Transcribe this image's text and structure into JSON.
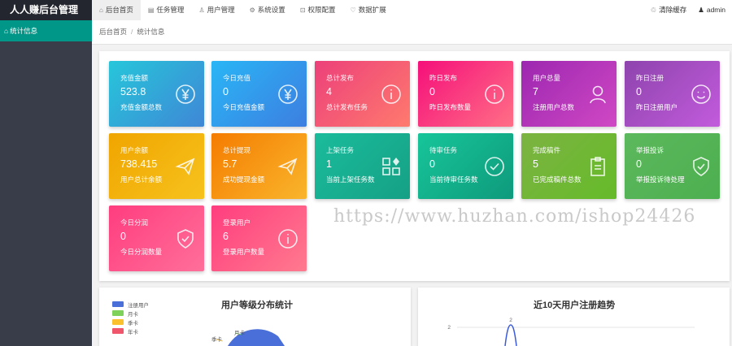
{
  "app": {
    "title": "人人赚后台管理"
  },
  "topnav": [
    {
      "label": "后台首页",
      "icon": "home-icon",
      "glyph": "⌂",
      "active": true
    },
    {
      "label": "任务管理",
      "icon": "task-icon",
      "glyph": "▤",
      "active": false
    },
    {
      "label": "用户管理",
      "icon": "user-icon",
      "glyph": "♙",
      "active": false
    },
    {
      "label": "系统设置",
      "icon": "gear-icon",
      "glyph": "⚙",
      "active": false
    },
    {
      "label": "权限配置",
      "icon": "lock-icon",
      "glyph": "⊡",
      "active": false
    },
    {
      "label": "数据扩展",
      "icon": "heart-icon",
      "glyph": "♡",
      "active": false
    }
  ],
  "topright": {
    "clear_cache": "清除缓存",
    "clear_cache_icon": "trash-icon",
    "clear_cache_glyph": "♲",
    "user": "admin",
    "user_icon": "person-icon",
    "user_glyph": "♟"
  },
  "sidebar": {
    "items": [
      {
        "label": "统计信息",
        "icon": "home-icon",
        "glyph": "⌂"
      }
    ]
  },
  "breadcrumb": {
    "home": "后台首页",
    "sep": "/",
    "current": "统计信息"
  },
  "cards": [
    {
      "title": "充值金额",
      "value": "523.8",
      "desc": "充值金额总数",
      "icon": "yen-icon",
      "colors": [
        "#26c6da",
        "#3f87d6"
      ]
    },
    {
      "title": "今日充值",
      "value": "0",
      "desc": "今日充值金额",
      "icon": "yen-icon",
      "colors": [
        "#29b6f6",
        "#3d7ee0"
      ]
    },
    {
      "title": "总计发布",
      "value": "4",
      "desc": "总计发布任务",
      "icon": "info-icon",
      "colors": [
        "#ec407a",
        "#ff7a6e"
      ]
    },
    {
      "title": "昨日发布",
      "value": "0",
      "desc": "昨日发布数量",
      "icon": "info-icon",
      "colors": [
        "#f50f7a",
        "#ff6f86"
      ]
    },
    {
      "title": "用户总量",
      "value": "7",
      "desc": "注册用户总数",
      "icon": "user-icon",
      "colors": [
        "#9c27b0",
        "#d048c4"
      ]
    },
    {
      "title": "昨日注册",
      "value": "0",
      "desc": "昨日注册用户",
      "icon": "smile-icon",
      "colors": [
        "#8e44ad",
        "#c25bdc"
      ]
    },
    {
      "title": "用户余额",
      "value": "738.415",
      "desc": "用户总计余额",
      "icon": "send-icon",
      "colors": [
        "#f0a500",
        "#f7c21d"
      ]
    },
    {
      "title": "总计提现",
      "value": "5.7",
      "desc": "成功提现金额",
      "icon": "send-icon",
      "colors": [
        "#f57c00",
        "#f9b52c"
      ]
    },
    {
      "title": "上架任务",
      "value": "1",
      "desc": "当前上架任务数",
      "icon": "apps-icon",
      "colors": [
        "#1abc9c",
        "#16a085"
      ]
    },
    {
      "title": "待审任务",
      "value": "0",
      "desc": "当前待审任务数",
      "icon": "check-circle-icon",
      "colors": [
        "#17c59a",
        "#0e9a7c"
      ]
    },
    {
      "title": "完成稿件",
      "value": "5",
      "desc": "已完成稿件总数",
      "icon": "clipboard-icon",
      "colors": [
        "#7cb342",
        "#66bb2a"
      ]
    },
    {
      "title": "举报投诉",
      "value": "0",
      "desc": "举报投诉待处理",
      "icon": "shield-check-icon",
      "colors": [
        "#5cb85c",
        "#4caf50"
      ]
    },
    {
      "title": "今日分润",
      "value": "0",
      "desc": "今日分润数量",
      "icon": "shield-check-icon",
      "colors": [
        "#ff3d7f",
        "#ff6f9a"
      ]
    },
    {
      "title": "登录用户",
      "value": "6",
      "desc": "登录用户数量",
      "icon": "info-icon",
      "colors": [
        "#ff3d7f",
        "#ff7a8e"
      ]
    }
  ],
  "watermark": "https://www.huzhan.com/ishop24426",
  "charts": {
    "pie_title": "用户等级分布统计",
    "legend": [
      {
        "label": "注册用户",
        "color": "#4a6fd8"
      },
      {
        "label": "月卡",
        "color": "#7ed15a"
      },
      {
        "label": "季卡",
        "color": "#fbc02d"
      },
      {
        "label": "年卡",
        "color": "#f0566b"
      }
    ],
    "pie_labels": [
      "月卡",
      "季卡"
    ],
    "line_title": "近10天用户注册趋势"
  },
  "chart_data": [
    {
      "type": "pie",
      "title": "用户等级分布统计",
      "categories": [
        "注册用户",
        "月卡",
        "季卡",
        "年卡"
      ],
      "legend_position": "top-left"
    },
    {
      "type": "line",
      "title": "近10天用户注册趋势",
      "ytick_labels": [
        "2"
      ],
      "data_labels": [
        "2"
      ],
      "peak_value": 2,
      "grid": true
    }
  ]
}
